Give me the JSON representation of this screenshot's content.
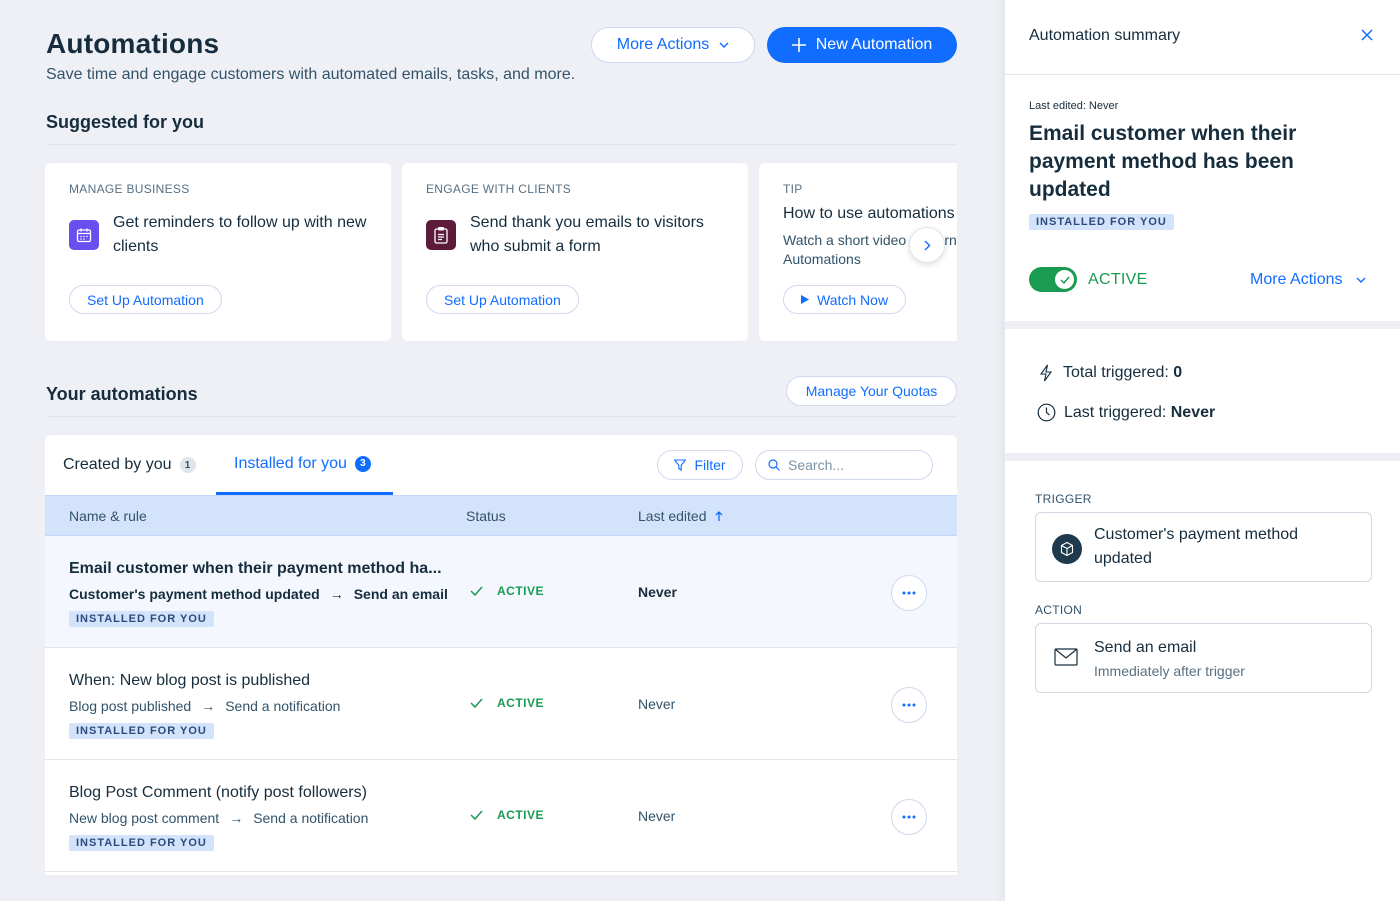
{
  "header": {
    "title": "Automations",
    "subtitle": "Save time and engage customers with automated emails, tasks, and more.",
    "more_actions_label": "More Actions",
    "new_automation_label": "New Automation"
  },
  "suggested": {
    "title": "Suggested for you",
    "cards": [
      {
        "category": "MANAGE BUSINESS",
        "text": "Get reminders to follow up with new clients",
        "button": "Set Up Automation",
        "icon": "calendar-icon",
        "color": "#6b4ef0"
      },
      {
        "category": "ENGAGE WITH CLIENTS",
        "text": "Send thank you emails to visitors who submit a form",
        "button": "Set Up Automation",
        "icon": "clipboard-icon",
        "color": "#5c1b3a"
      },
      {
        "category": "TIP",
        "text": "How to use automations",
        "subtext": "Watch a short video to learn Automations",
        "button": "Watch Now",
        "icon": "play-icon"
      }
    ]
  },
  "automations": {
    "title": "Your automations",
    "manage_quotas_label": "Manage Your Quotas",
    "tabs": [
      {
        "label": "Created by you",
        "count": "1"
      },
      {
        "label": "Installed for you",
        "count": "3"
      }
    ],
    "filter_label": "Filter",
    "search_placeholder": "Search...",
    "columns": {
      "name": "Name & rule",
      "status": "Status",
      "edited": "Last edited"
    },
    "rows": [
      {
        "name": "Email customer when their payment method ha...",
        "trigger": "Customer's payment method updated",
        "action": "Send an email",
        "badge": "INSTALLED FOR YOU",
        "status": "ACTIVE",
        "edited": "Never"
      },
      {
        "name": "When: New blog post is published",
        "trigger": "Blog post published",
        "action": "Send a notification",
        "badge": "INSTALLED FOR YOU",
        "status": "ACTIVE",
        "edited": "Never"
      },
      {
        "name": "Blog Post Comment (notify post followers)",
        "trigger": "New blog post comment",
        "action": "Send a notification",
        "badge": "INSTALLED FOR YOU",
        "status": "ACTIVE",
        "edited": "Never"
      }
    ]
  },
  "panel": {
    "header": "Automation summary",
    "last_edited": "Last edited: Never",
    "title": "Email customer when their payment method has been updated",
    "badge": "INSTALLED FOR YOU",
    "status": "ACTIVE",
    "more_actions_label": "More Actions",
    "total_triggered_label": "Total triggered:",
    "total_triggered_value": "0",
    "last_triggered_label": "Last triggered:",
    "last_triggered_value": "Never",
    "trigger_label": "TRIGGER",
    "trigger_text": "Customer's payment method updated",
    "action_label": "ACTION",
    "action_title": "Send an email",
    "action_sub": "Immediately after trigger"
  },
  "colors": {
    "accent": "#116dff",
    "active": "#1a9b52",
    "text": "#162d3d",
    "header_row": "#d3e3fc"
  }
}
